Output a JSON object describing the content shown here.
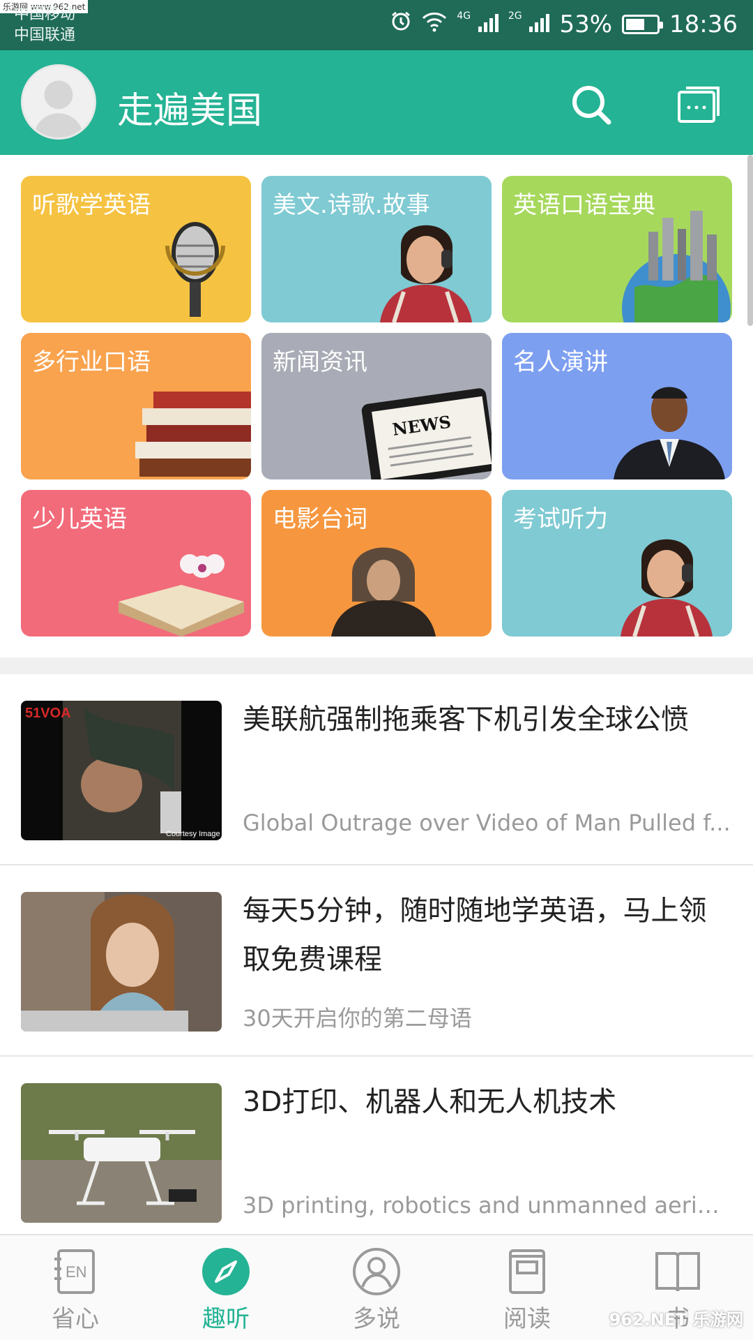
{
  "status_bar": {
    "watermark": "乐游网 www.962.net",
    "carrier_1": "中国移动",
    "carrier_2": "中国联通",
    "net_1": "4G",
    "net_2": "2G",
    "battery": "53%",
    "time": "18:36"
  },
  "header": {
    "title": "走遍美国",
    "search_icon": "search-icon",
    "messages_icon": "chat-icon"
  },
  "categories": [
    {
      "label": "听歌学英语",
      "color": "#f5c242",
      "icon": "microphone"
    },
    {
      "label": "美文.诗歌.故事",
      "color": "#7fcad3",
      "icon": "woman-headphones"
    },
    {
      "label": "英语口语宝典",
      "color": "#a6d85c",
      "icon": "globe-city"
    },
    {
      "label": "多行业口语",
      "color": "#f9a34e",
      "icon": "books"
    },
    {
      "label": "新闻资讯",
      "color": "#a9acb6",
      "icon": "news-tablet"
    },
    {
      "label": "名人演讲",
      "color": "#7d9ff0",
      "icon": "speaker"
    },
    {
      "label": "少儿英语",
      "color": "#f26b7a",
      "icon": "open-book"
    },
    {
      "label": "电影台词",
      "color": "#f6973f",
      "icon": "hooded-man"
    },
    {
      "label": "考试听力",
      "color": "#7fcad3",
      "icon": "woman-headphones"
    }
  ],
  "articles": [
    {
      "title": "美联航强制拖乘客下机引发全球公愤",
      "subtitle": "Global Outrage over Video of Man Pulled f...",
      "thumb_caption": "Courtesy Image",
      "thumb_logo": "51VOA"
    },
    {
      "title": "每天5分钟，随时随地学英语，马上领取免费课程",
      "subtitle": "30天开启你的第二母语"
    },
    {
      "title": "3D打印、机器人和无人机技术",
      "subtitle": "3D printing, robotics and unmanned aerial..."
    }
  ],
  "bottom_nav": [
    {
      "label": "省心",
      "icon": "en-notebook-icon",
      "active": false,
      "icon_text": "EN"
    },
    {
      "label": "趣听",
      "icon": "compass-icon",
      "active": true
    },
    {
      "label": "多说",
      "icon": "person-icon",
      "active": false
    },
    {
      "label": "阅读",
      "icon": "reader-icon",
      "active": false
    },
    {
      "label": "书",
      "icon": "open-book-icon",
      "active": false
    }
  ],
  "watermark_bottom": "962.NET 乐游网",
  "colors": {
    "primary": "#24b394",
    "statusbar": "#1f6b58"
  }
}
